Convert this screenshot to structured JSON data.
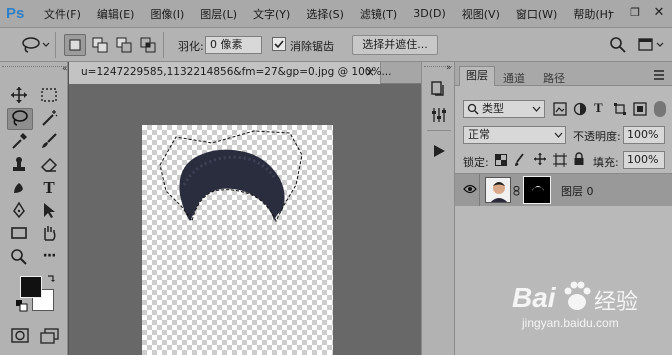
{
  "app": {
    "logo": "Ps"
  },
  "menu": [
    "文件(F)",
    "编辑(E)",
    "图像(I)",
    "图层(L)",
    "文字(Y)",
    "选择(S)",
    "滤镜(T)",
    "3D(D)",
    "视图(V)",
    "窗口(W)",
    "帮助(H)"
  ],
  "window_controls": {
    "minimize": "–",
    "restore": "❐",
    "close": "✕"
  },
  "options": {
    "feather_label": "羽化:",
    "feather_value": "0 像素",
    "antialias_label": "消除锯齿",
    "antialias_checked": true,
    "mask_button": "选择并遮住..."
  },
  "document": {
    "tab_title": "u=1247229585,1132214856&fm=27&gp=0.jpg @ 100%...",
    "tab_close": "×"
  },
  "tools": [
    {
      "name": "move-tool",
      "icon": "move-icon"
    },
    {
      "name": "marquee-tool",
      "icon": "marquee-icon"
    },
    {
      "name": "lasso-tool",
      "icon": "lasso-icon",
      "active": true
    },
    {
      "name": "magic-wand-tool",
      "icon": "magic-wand-icon"
    },
    {
      "name": "eyedropper-tool",
      "icon": "eyedropper-icon"
    },
    {
      "name": "brush-tool",
      "icon": "brush-icon"
    },
    {
      "name": "stamp-tool",
      "icon": "stamp-icon"
    },
    {
      "name": "eraser-tool",
      "icon": "eraser-icon"
    },
    {
      "name": "smudge-tool",
      "icon": "smudge-icon"
    },
    {
      "name": "type-tool",
      "icon": "type-icon",
      "text": "T"
    },
    {
      "name": "pen-tool",
      "icon": "pen-icon"
    },
    {
      "name": "path-select-tool",
      "icon": "arrow-icon"
    },
    {
      "name": "rectangle-tool",
      "icon": "rectangle-icon"
    },
    {
      "name": "hand-tool",
      "icon": "hand-icon"
    },
    {
      "name": "zoom-tool",
      "icon": "zoom-icon"
    },
    {
      "name": "more-tools",
      "icon": "ellipsis-icon",
      "text": "···"
    }
  ],
  "colors": {
    "foreground": "#111111",
    "background": "#ffffff",
    "accent": "#2d80c8"
  },
  "layers_panel": {
    "tabs": [
      "图层",
      "通道",
      "路径"
    ],
    "filter_label": "类型",
    "blend_mode": "正常",
    "opacity_label": "不透明度:",
    "opacity_value": "100%",
    "lock_label": "锁定:",
    "fill_label": "填充:",
    "fill_value": "100%",
    "layers": [
      {
        "name": "图层 0",
        "visible": true
      }
    ]
  },
  "watermark": {
    "brand": "Bai",
    "brand2": "经验",
    "url": "jingyan.baidu.com"
  }
}
